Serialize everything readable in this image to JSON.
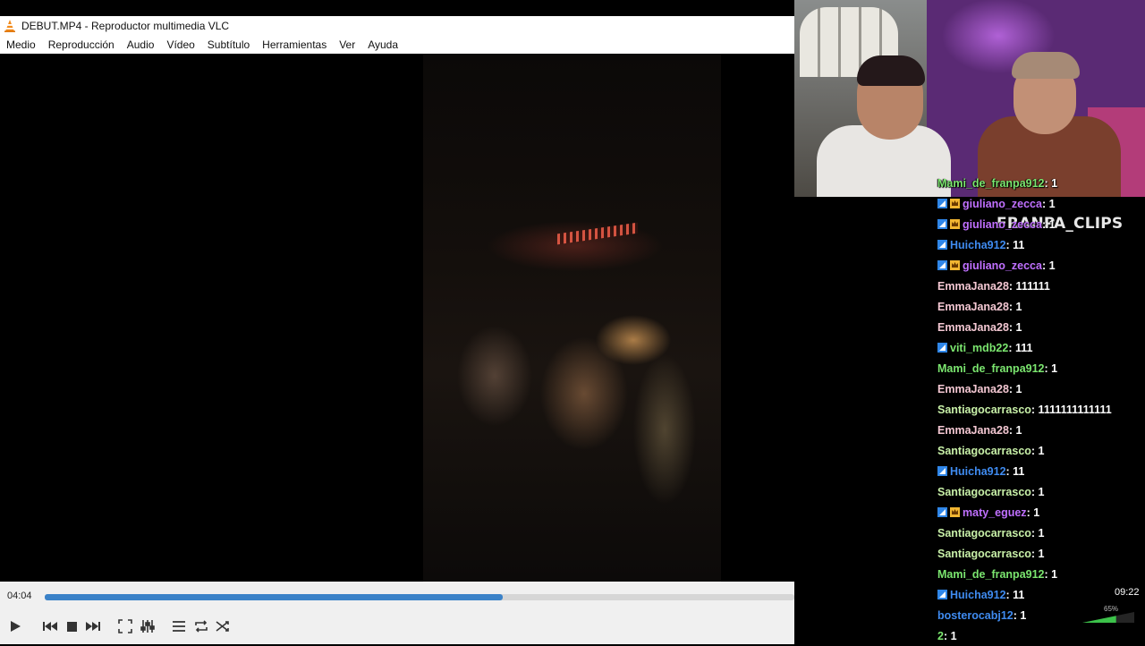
{
  "window": {
    "title": "DEBUT.MP4 - Reproductor multimedia VLC"
  },
  "menu": [
    "Medio",
    "Reproducción",
    "Audio",
    "Vídeo",
    "Subtítulo",
    "Herramientas",
    "Ver",
    "Ayuda"
  ],
  "player": {
    "current_time": "04:04",
    "total_time": "09:22",
    "progress_fraction": 0.611,
    "volume_label": "65%",
    "volume_fraction": 0.65
  },
  "overlay": {
    "watermark": "FRANPA_CLIPS"
  },
  "colors": {
    "seek_fill": "#3b82c8",
    "badge_blue": "#2f86e8",
    "badge_gold": "#f2b632"
  },
  "chat": [
    {
      "user": "Mami_de_franpa912",
      "text": " : 1",
      "color": "#7be66f",
      "badges": []
    },
    {
      "user": "giuliano_zecca",
      "text": " : 1",
      "color": "#c070ff",
      "badges": [
        "prime-icon",
        "crown-icon"
      ]
    },
    {
      "user": "giuliano_zecca",
      "text": " : 1",
      "color": "#c070ff",
      "badges": [
        "prime-icon",
        "crown-icon"
      ]
    },
    {
      "user": "Huicha912",
      "text": " : 11",
      "color": "#3f8bf0",
      "badges": [
        "prime-icon"
      ]
    },
    {
      "user": "giuliano_zecca",
      "text": " : 1",
      "color": "#c070ff",
      "badges": [
        "prime-icon",
        "crown-icon"
      ]
    },
    {
      "user": "EmmaJana28",
      "text": " : 111111",
      "color": "#f3c7d2",
      "badges": []
    },
    {
      "user": "EmmaJana28",
      "text": " : 1",
      "color": "#f3c7d2",
      "badges": []
    },
    {
      "user": "EmmaJana28",
      "text": " : 1",
      "color": "#f3c7d2",
      "badges": []
    },
    {
      "user": "viti_mdb22",
      "text": " : 111",
      "color": "#7be66f",
      "badges": [
        "prime-icon"
      ]
    },
    {
      "user": "Mami_de_franpa912",
      "text": " : 1",
      "color": "#7be66f",
      "badges": []
    },
    {
      "user": "EmmaJana28",
      "text": " : 1",
      "color": "#f3c7d2",
      "badges": []
    },
    {
      "user": "Santiagocarrasco",
      "text": " : 1111111111111",
      "color": "#c8f0a8",
      "badges": []
    },
    {
      "user": "EmmaJana28",
      "text": " : 1",
      "color": "#f3c7d2",
      "badges": []
    },
    {
      "user": "Santiagocarrasco",
      "text": " : 1",
      "color": "#c8f0a8",
      "badges": []
    },
    {
      "user": "Huicha912",
      "text": " : 11",
      "color": "#3f8bf0",
      "badges": [
        "prime-icon"
      ]
    },
    {
      "user": "Santiagocarrasco",
      "text": " : 1",
      "color": "#c8f0a8",
      "badges": []
    },
    {
      "user": "maty_eguez",
      "text": " : 1",
      "color": "#c070ff",
      "badges": [
        "prime-icon",
        "crown-icon"
      ]
    },
    {
      "user": "Santiagocarrasco",
      "text": " : 1",
      "color": "#c8f0a8",
      "badges": []
    },
    {
      "user": "Santiagocarrasco",
      "text": " : 1",
      "color": "#c8f0a8",
      "badges": []
    },
    {
      "user": "Mami_de_franpa912",
      "text": " : 1",
      "color": "#7be66f",
      "badges": []
    },
    {
      "user": "Huicha912",
      "text": " : 11",
      "color": "#3f8bf0",
      "badges": [
        "prime-icon"
      ]
    },
    {
      "user": "bosterocabj12",
      "text": " : 1",
      "color": "#3f8bf0",
      "badges": []
    },
    {
      "user": "2",
      "text": " : 1",
      "color": "#7be66f",
      "badges": []
    }
  ]
}
